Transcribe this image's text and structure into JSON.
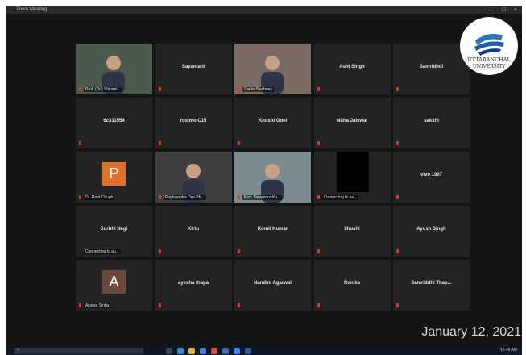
{
  "titlebar": {
    "title": "Zoom Meeting",
    "min": "—",
    "max": "□",
    "close": "×"
  },
  "participants": [
    {
      "name": "Prof. (Dr.) Shivani...",
      "kind": "video",
      "bg": "#4b5a4c"
    },
    {
      "name": "Sayantani",
      "kind": "name"
    },
    {
      "name": "Sarita Sawhney",
      "kind": "video",
      "bg": "#7a6a63"
    },
    {
      "name": "Ashi Singh",
      "kind": "name"
    },
    {
      "name": "Samridhdi",
      "kind": "name"
    },
    {
      "name": "6c311554",
      "kind": "name"
    },
    {
      "name": "rosimo C15",
      "kind": "name"
    },
    {
      "name": "Khushi Goel",
      "kind": "name"
    },
    {
      "name": "Nitha Jaiswal",
      "kind": "name"
    },
    {
      "name": "sakshi",
      "kind": "name"
    },
    {
      "name": "Dr. Reet Chugh",
      "kind": "avatar",
      "letter": "P",
      "color": "#e0702a"
    },
    {
      "name": "Raghvendra Dev Ph...",
      "kind": "video",
      "bg": "#3f3f3f"
    },
    {
      "name": "Prof. Devendra Ku...",
      "kind": "video",
      "bg": "#7b8b8f",
      "active": true
    },
    {
      "name": "Connecting to au...",
      "kind": "black"
    },
    {
      "name": "vivo 1907",
      "kind": "name"
    },
    {
      "name": "Surbhi Negi",
      "kind": "name",
      "caption": "Connecting to au..."
    },
    {
      "name": "Kirtu",
      "kind": "name"
    },
    {
      "name": "Komil Kumar",
      "kind": "name"
    },
    {
      "name": "khushi",
      "kind": "name"
    },
    {
      "name": "Ayush Singh",
      "kind": "name"
    },
    {
      "name": "Akshat Sinha",
      "kind": "avatar",
      "letter": "A",
      "color": "#6b4a3a"
    },
    {
      "name": "ayesha thapa",
      "kind": "name"
    },
    {
      "name": "Nandini Agarwal",
      "kind": "name"
    },
    {
      "name": "Ronika",
      "kind": "name"
    },
    {
      "name": "Samriddhi Thap...",
      "kind": "name"
    }
  ],
  "logo": {
    "line1": "UTTARANCHAL",
    "line2": "UNIVERSITY"
  },
  "date": "January 12, 2021",
  "taskbar": {
    "search_placeholder": "Type here to search",
    "clock": "10:46 AM"
  }
}
